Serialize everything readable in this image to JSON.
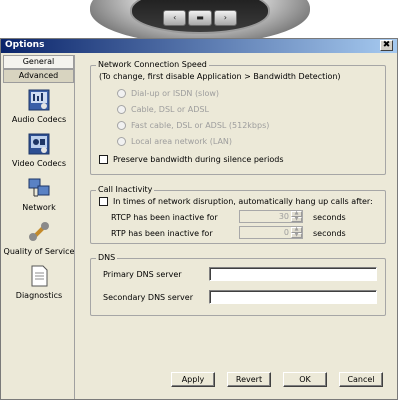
{
  "device": {
    "keys": [
      "‹",
      "▬",
      "›"
    ]
  },
  "dialog": {
    "title": "Options",
    "close_label": "✖"
  },
  "sidebar": {
    "tabs": [
      {
        "label": "General",
        "active": false
      },
      {
        "label": "Advanced",
        "active": true
      }
    ],
    "items": [
      {
        "label": "Audio Codecs",
        "icon": "audio-codecs-icon"
      },
      {
        "label": "Video Codecs",
        "icon": "video-codecs-icon"
      },
      {
        "label": "Network",
        "icon": "network-icon"
      },
      {
        "label": "Quality of Service",
        "icon": "quality-of-service-icon"
      },
      {
        "label": "Diagnostics",
        "icon": "diagnostics-icon"
      }
    ]
  },
  "network_speed": {
    "title": "Network Connection Speed",
    "note": "(To change, first disable Application > Bandwidth Detection)",
    "options": [
      "Dial-up or ISDN (slow)",
      "Cable, DSL or ADSL",
      "Fast cable, DSL or ADSL (512kbps)",
      "Local area network (LAN)"
    ],
    "preserve_label": "Preserve bandwidth during silence periods"
  },
  "call_inactivity": {
    "title": "Call Inactivity",
    "hangup_label": "In times of network disruption, automatically hang up calls after:",
    "rtcp_label": "RTCP has been inactive for",
    "rtcp_value": "30",
    "rtp_label": "RTP has been inactive for",
    "rtp_value": "0",
    "unit": "seconds"
  },
  "dns": {
    "title": "DNS",
    "primary_label": "Primary DNS server",
    "primary_value": "",
    "secondary_label": "Secondary DNS server",
    "secondary_value": ""
  },
  "buttons": {
    "apply": "Apply",
    "revert": "Revert",
    "ok": "OK",
    "cancel": "Cancel"
  },
  "colors": {
    "titlebar_start": "#0a246a",
    "titlebar_end": "#a6caf0",
    "dialog_bg": "#ece9d8"
  }
}
